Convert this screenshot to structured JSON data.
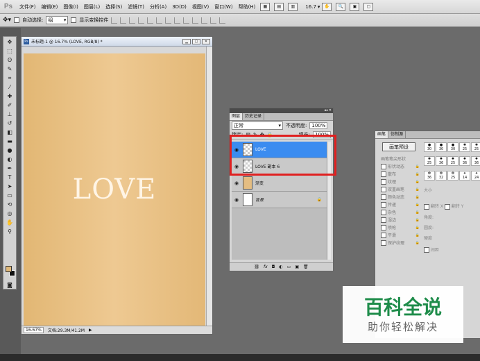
{
  "menubar": {
    "logo": "Ps",
    "items": [
      "文件(F)",
      "编辑(E)",
      "图像(I)",
      "图层(L)",
      "选择(S)",
      "滤镜(T)",
      "分析(A)",
      "3D(D)",
      "视图(V)",
      "窗口(W)",
      "帮助(H)"
    ],
    "zoom": "16.7"
  },
  "options": {
    "auto_select_label": "自动选择:",
    "auto_select_value": "组",
    "show_transform_label": "显示变换控件"
  },
  "document": {
    "title": "未标题-1 @ 16.7% (LOVE, RGB/8) *",
    "canvas_text": "LOVE",
    "zoom_status": "16.67%",
    "doc_status": "文档:29.3M/41.2M",
    "canvas_colors": {
      "left": "#e2b774",
      "center": "#eec992"
    }
  },
  "layers_panel": {
    "tabs": [
      "图层",
      "历史记录"
    ],
    "blend_mode": "正常",
    "opacity_label": "不透明度:",
    "opacity_value": "100%",
    "lock_label": "锁定:",
    "fill_label": "填充:",
    "fill_value": "100%",
    "layers": [
      {
        "name": "LOVE",
        "thumb": "check",
        "selected": true
      },
      {
        "name": "LOVE 副本 6",
        "thumb": "check",
        "selected": false
      },
      {
        "name": "渐变",
        "thumb": "orange",
        "selected": false
      },
      {
        "name": "背景",
        "thumb": "white",
        "selected": false
      }
    ],
    "accent_color": "#3b8cf0"
  },
  "brushes_panel": {
    "tabs": [
      "画笔",
      "仿制源"
    ],
    "preset_button": "画笔预设",
    "options": [
      "画笔笔尖形状",
      "形状动态",
      "散布",
      "纹理",
      "双重画笔",
      "颜色动态",
      "传递",
      "杂色",
      "湿边",
      "喷枪",
      "平滑",
      "保护纹理"
    ],
    "sizes": [
      "30",
      "30",
      "30",
      "25",
      "25",
      "25",
      "36",
      "25",
      "36",
      "36",
      "36",
      "32",
      "25",
      "14",
      "24"
    ],
    "labels": {
      "size": "大小",
      "flip_x": "翻转 X",
      "flip_y": "翻转 Y",
      "angle": "角度:",
      "roundness": "圆度:",
      "hardness": "硬度",
      "spacing": "间距"
    }
  },
  "watermark": {
    "title": "百科全说",
    "subtitle": "助你轻松解决"
  },
  "highlight_color": "#e02020"
}
